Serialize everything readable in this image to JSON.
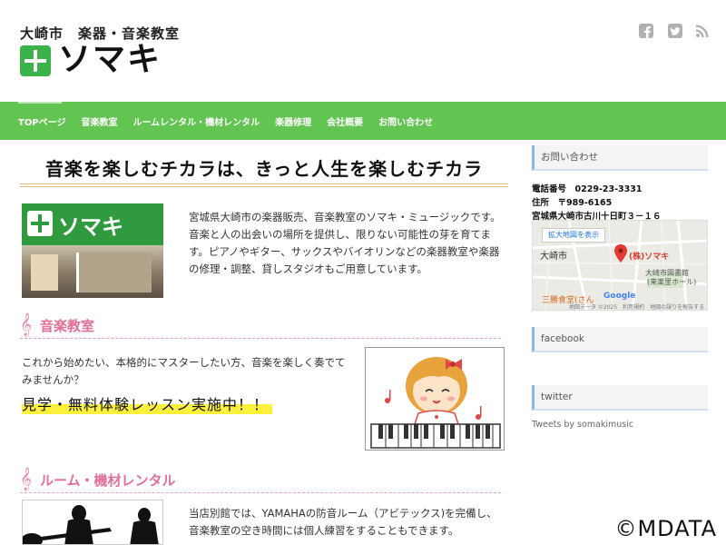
{
  "header": {
    "tagline": "大崎市　楽器・音楽教室",
    "logo_text": "ソマキ",
    "social_icons": [
      "facebook-icon",
      "twitter-icon",
      "rss-icon"
    ]
  },
  "nav": {
    "items": [
      {
        "label": "TOPページ"
      },
      {
        "label": "音楽教室"
      },
      {
        "label": "ルームレンタル・機材レンタル"
      },
      {
        "label": "楽器修理"
      },
      {
        "label": "会社概要"
      },
      {
        "label": "お問い合わせ"
      }
    ]
  },
  "main": {
    "hero_title": "音楽を楽しむチカラは、きっと人生を楽しむチカラ",
    "shop_sign": "ソマキ",
    "intro": "宮城県大崎市の楽器販売、音楽教室のソマキ・ミュージックです。音楽と人の出会いの場所を提供し、限りない可能性の芽を育てます。ピアノやギター、サックスやバイオリンなどの楽器教室や楽器の修理・調整、貸しスタジオもご用意しています。",
    "lesson": {
      "title": "音楽教室",
      "text": "これから始めたい、本格的にマスターしたい方、音楽を楽しく奏でてみませんか？",
      "highlight": "見学・無料体験レッスン実施中！！"
    },
    "rental": {
      "title": "ルーム・機材レンタル",
      "text": "当店別館では、YAMAHAの防音ルーム（アビテックス)を完備し、音楽教室の空き時間には個人練習をすることもできます。"
    }
  },
  "sidebar": {
    "contact": {
      "title": "お問い合わせ",
      "phone": "電話番号　0229-23-3331",
      "address1": "住所　〒989-6165",
      "address2": "宮城県大崎市古川十日町３－１６"
    },
    "map": {
      "enlarge_button": "拡大地図を表示",
      "shop_label": "(株)ソマキ",
      "label_area": "大崎市",
      "label_library1": "大崎市図書館",
      "label_library2": "(来楽里ホール)",
      "label_restaurant": "三勝食堂(さん",
      "brand": "Google",
      "footer": "地図データ ©2025　利用規約　地図の誤りを報告する"
    },
    "facebook_title": "facebook",
    "twitter_title": "twitter",
    "twitter_note": "Tweets by somakimusic"
  },
  "watermark": "©MDATA",
  "colors": {
    "nav_green": "#62c552",
    "logo_green": "#3cb34a",
    "section_pink": "#e26f96",
    "highlight_yellow": "#fbf03c",
    "widget_accent": "#8fb5e0"
  }
}
